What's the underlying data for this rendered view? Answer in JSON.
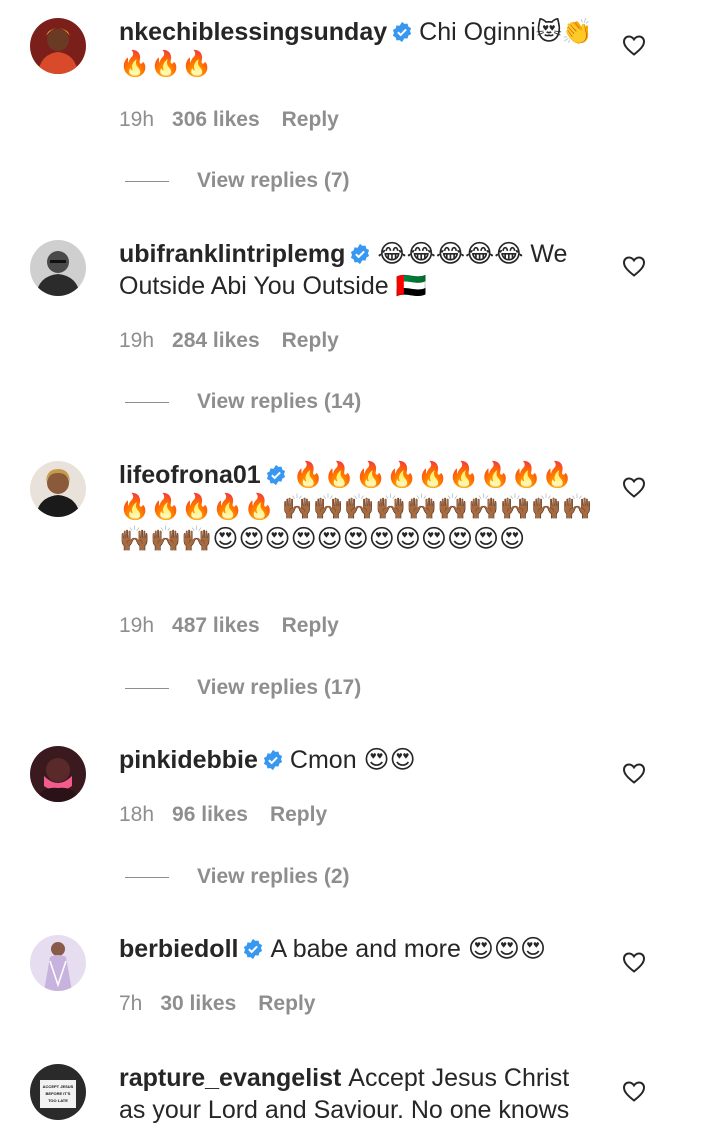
{
  "comments": [
    {
      "username": "nkechiblessingsunday",
      "text": "Chi Oginni😻👏🔥🔥🔥",
      "time": "19h",
      "likes": "306 likes",
      "reply": "Reply",
      "view_replies": "View replies (7)",
      "avatar_icon": "avatar-red-outfit"
    },
    {
      "username": "ubifranklintriplemg",
      "text": "😂😂😂😂😂 We Outside Abi You Outside 🇦🇪",
      "time": "19h",
      "likes": "284 likes",
      "reply": "Reply",
      "view_replies": "View replies (14)",
      "avatar_icon": "avatar-grayscale-man"
    },
    {
      "username": "lifeofrona01",
      "text": "🔥🔥🔥🔥🔥🔥🔥🔥🔥🔥🔥🔥🔥🔥 🙌🏾🙌🏾🙌🏾🙌🏾🙌🏾🙌🏾🙌🏾🙌🏾🙌🏾🙌🏾🙌🏾🙌🏾🙌🏾😍😍😍😍😍😍😍😍😍😍😍😍",
      "time": "19h",
      "likes": "487 likes",
      "reply": "Reply",
      "view_replies": "View replies (17)",
      "avatar_icon": "avatar-woman-black-top"
    },
    {
      "username": "pinkidebbie",
      "text": "Cmon 😍😍",
      "time": "18h",
      "likes": "96 likes",
      "reply": "Reply",
      "view_replies": "View replies (2)",
      "avatar_icon": "avatar-pink-mask"
    },
    {
      "username": "berbiedoll",
      "text": "A babe and more 😍😍😍",
      "time": "7h",
      "likes": "30 likes",
      "reply": "Reply",
      "avatar_icon": "avatar-lavender-dress"
    },
    {
      "username": "rapture_evangelist",
      "text": "Accept Jesus Christ as your Lord and Saviour. No one knows",
      "avatar_icon": "avatar-sign-holder",
      "avatar_sign_text": "ACCEPT JESUS BEFORE IT'S TOO LATE"
    }
  ],
  "colors": {
    "text": "#262626",
    "secondary": "#8e8e8e",
    "verified": "#3897f0"
  },
  "icons": {
    "verified": "verified-badge-icon",
    "like": "heart-outline-icon"
  }
}
